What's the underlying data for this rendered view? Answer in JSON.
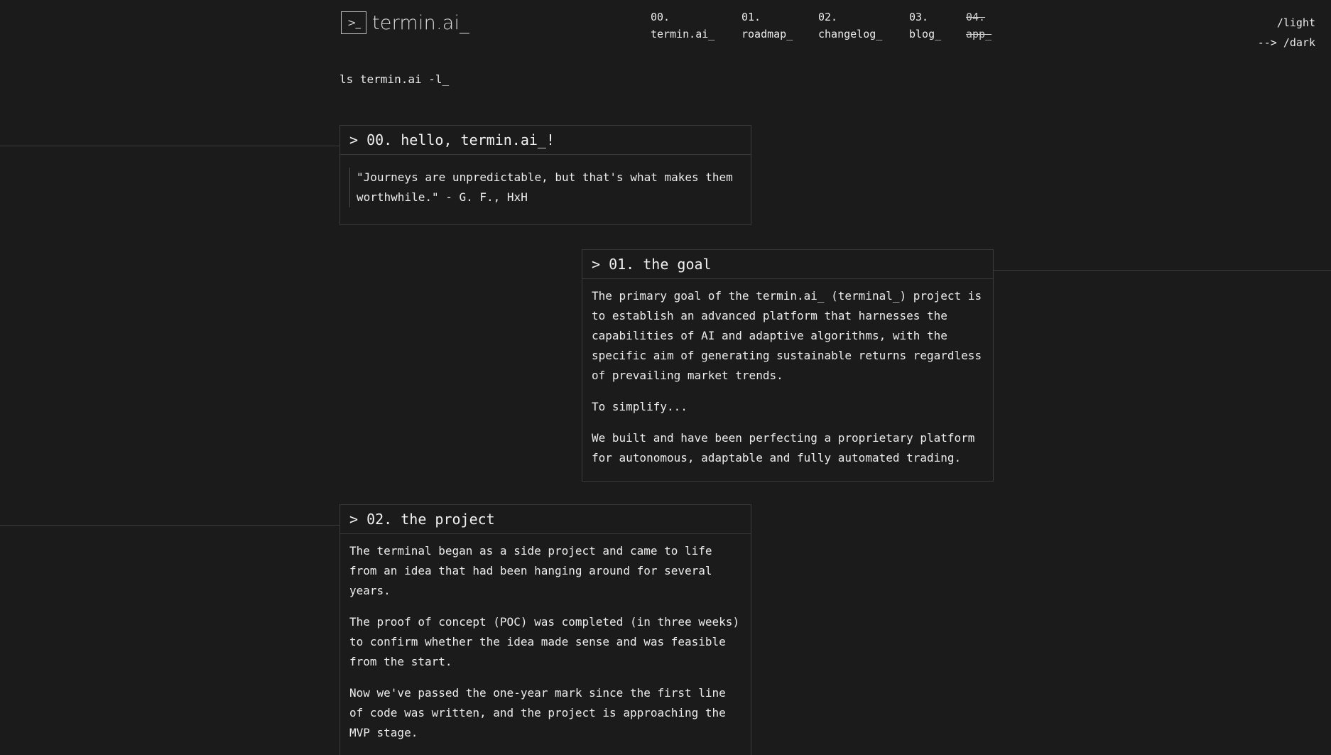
{
  "header": {
    "logo_glyph": ">_",
    "logo_text": "termin.ai_",
    "nav": [
      {
        "num": "00.",
        "label": "termin.ai_"
      },
      {
        "num": "01.",
        "label": "roadmap_"
      },
      {
        "num": "02.",
        "label": "changelog_"
      },
      {
        "num": "03.",
        "label": "blog_"
      },
      {
        "num": "04.",
        "label": "app_",
        "disabled": true
      }
    ],
    "theme": {
      "light": "/light",
      "dark": "--> /dark"
    }
  },
  "command": "ls termin.ai -l_",
  "sections": [
    {
      "title": "> 00. hello, termin.ai_!",
      "quote": "\"Journeys are unpredictable, but that's what makes them worthwhile.\" - G. F., HxH"
    },
    {
      "title": "> 01. the goal",
      "paragraphs": [
        "The primary goal of the termin.ai_ (terminal_) project is to establish an advanced platform that harnesses the capabilities of AI and adaptive algorithms, with the specific aim of generating sustainable returns regardless of prevailing market trends.",
        "To simplify...",
        "We built and have been perfecting a proprietary platform for autonomous, adaptable and fully automated trading."
      ]
    },
    {
      "title": "> 02. the project",
      "paragraphs": [
        "The terminal began as a side project and came to life from an idea that had been hanging around for several years.",
        "The proof of concept (POC) was completed (in three weeks) to confirm whether the idea made sense and was feasible from the start.",
        "Now we've passed the one-year mark since the first line of code was written, and the project is approaching the MVP stage."
      ]
    }
  ]
}
